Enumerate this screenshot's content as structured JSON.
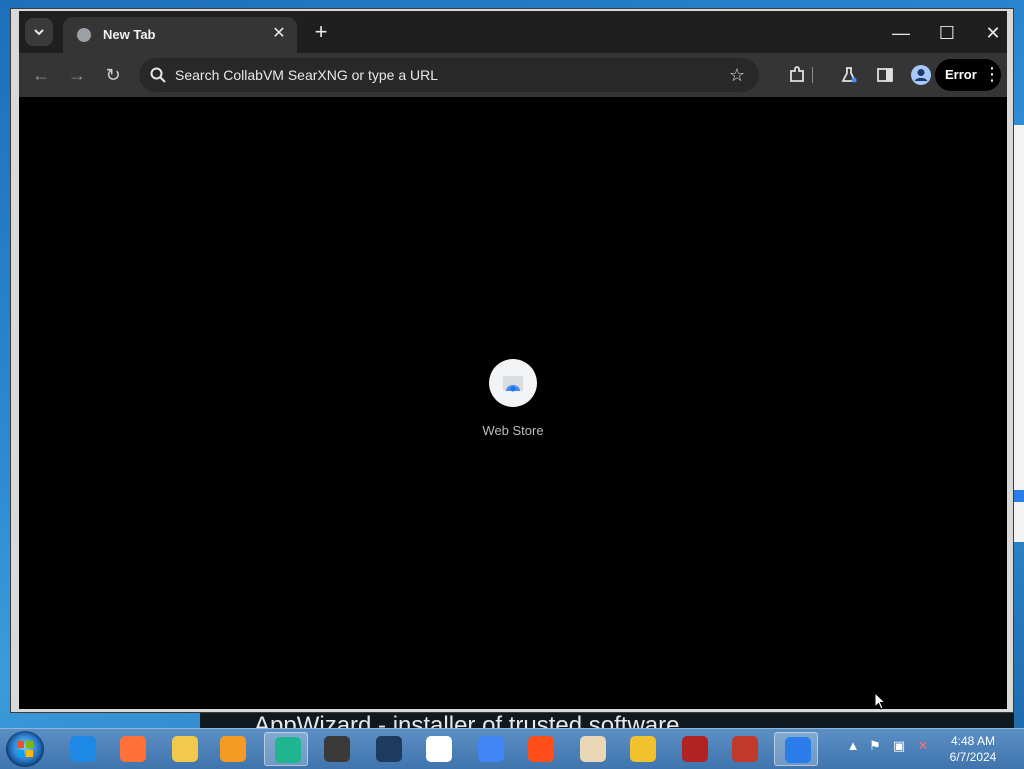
{
  "browser": {
    "tab": {
      "title": "New Tab",
      "close_icon": "close-icon"
    },
    "new_tab_icon": "plus-icon",
    "window_controls": {
      "minimize": "—",
      "maximize": "☐",
      "close": "✕"
    },
    "toolbar": {
      "omnibox_placeholder": "Search CollabVM SearXNG or type a URL",
      "error_label": "Error"
    },
    "shortcuts": [
      {
        "label": "Web Store",
        "icon": "web-store-icon"
      }
    ]
  },
  "background_text": "AppWizard - installer of trusted software",
  "taskbar": {
    "apps": [
      {
        "name": "internet-explorer-icon",
        "color": "#1e88e5"
      },
      {
        "name": "firefox-icon",
        "color": "#ff7139"
      },
      {
        "name": "file-explorer-icon",
        "color": "#f2c94c"
      },
      {
        "name": "media-player-icon",
        "color": "#f59b23"
      },
      {
        "name": "browser-app-icon",
        "color": "#1fb58f"
      },
      {
        "name": "world-of-tanks-icon",
        "color": "#3a3a3a"
      },
      {
        "name": "world-of-warships-icon",
        "color": "#1e3a5f"
      },
      {
        "name": "yandex-icon",
        "color": "#ffffff"
      },
      {
        "name": "chrome-icon",
        "color": "#4285f4"
      },
      {
        "name": "aliexpress-icon",
        "color": "#ff4e1a"
      },
      {
        "name": "game-icon",
        "color": "#e9d7b5"
      },
      {
        "name": "game-badge-icon",
        "color": "#f2c12e"
      },
      {
        "name": "rn-icon",
        "color": "#b22222"
      },
      {
        "name": "star-icon",
        "color": "#c0392b"
      },
      {
        "name": "appwizard-icon",
        "color": "#2b7de9"
      }
    ],
    "clock": {
      "time": "4:48 AM",
      "date": "6/7/2024"
    }
  }
}
